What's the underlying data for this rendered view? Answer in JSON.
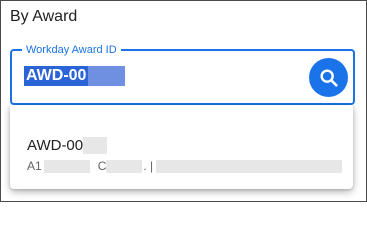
{
  "section": {
    "title": "By Award"
  },
  "search_field": {
    "label": "Workday Award ID",
    "value": "AWD-00"
  },
  "search_button": {
    "icon": "search-icon",
    "color": "#1a73e8"
  },
  "dropdown": {
    "options": [
      {
        "primary": "AWD-00",
        "secondary_prefix": "A1",
        "secondary_mid": "C",
        "secondary_sep": ". |"
      }
    ]
  },
  "colors": {
    "accent": "#1a73e8",
    "selection": "#2b64d6"
  }
}
